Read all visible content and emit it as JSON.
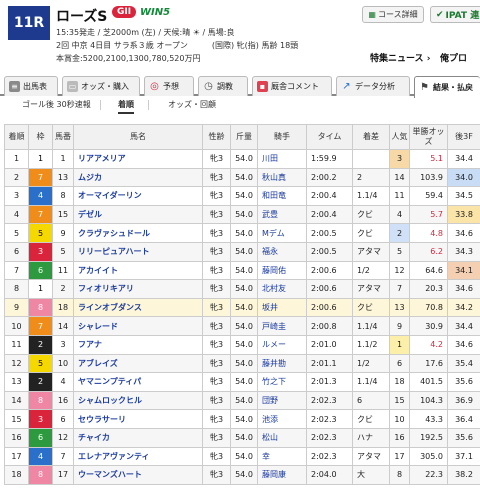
{
  "race": {
    "number": "11R",
    "name": "ローズS",
    "grade": "GII",
    "win5": "WIN5",
    "info1": "15:35発走 / 芝2000m (左) / 天候:晴 ☀ / 馬場:良",
    "info2": "2回 中京 4日目 サラ系３歳 オープン　　　(国際) 牝(指) 馬齢 18頭",
    "info3": "本賞金:5200,2100,1300,780,520万円"
  },
  "header_buttons": {
    "course": "コース詳細",
    "ipat": "IPAT 連",
    "special": "特集ニュース",
    "mypred": "俺プロ"
  },
  "tabs": [
    {
      "label": "出馬表",
      "icon": "list-icon"
    },
    {
      "label": "オッズ・購入",
      "icon": "ticket-icon"
    },
    {
      "label": "予想",
      "icon": "target-icon"
    },
    {
      "label": "調教",
      "icon": "stopwatch-icon"
    },
    {
      "label": "厩舎コメント",
      "icon": "comment-icon"
    },
    {
      "label": "データ分析",
      "icon": "chart-icon"
    },
    {
      "label": "結果・払戻",
      "icon": "flag-icon"
    }
  ],
  "subtabs": [
    "ゴール後 30秒速報",
    "着順",
    "オッズ・回顧"
  ],
  "columns": {
    "finish": "着順",
    "waku": "枠",
    "umaban": "馬番",
    "name": "馬名",
    "sexage": "性齢",
    "weight": "斤量",
    "jockey": "騎手",
    "time": "タイム",
    "margin": "着差",
    "pop": "人気",
    "odds": "単勝オッズ",
    "last3f": "後3F"
  },
  "rows": [
    {
      "finish": "1",
      "waku": "1",
      "umaban": "1",
      "name": "リアアメリア",
      "sexage": "牝3",
      "weight": "54.0",
      "jockey": "川田",
      "time": "1:59.9",
      "margin": "",
      "pop": "3",
      "odds": "5.1",
      "last3f": "34.4"
    },
    {
      "finish": "2",
      "waku": "7",
      "umaban": "13",
      "name": "ムジカ",
      "sexage": "牝3",
      "weight": "54.0",
      "jockey": "秋山真",
      "time": "2:00.2",
      "margin": "2",
      "pop": "14",
      "odds": "103.9",
      "last3f": "34.0"
    },
    {
      "finish": "3",
      "waku": "4",
      "umaban": "8",
      "name": "オーマイダーリン",
      "sexage": "牝3",
      "weight": "54.0",
      "jockey": "和田竜",
      "time": "2:00.4",
      "margin": "1.1/4",
      "pop": "11",
      "odds": "59.4",
      "last3f": "34.5"
    },
    {
      "finish": "4",
      "waku": "7",
      "umaban": "15",
      "name": "デゼル",
      "sexage": "牝3",
      "weight": "54.0",
      "jockey": "武豊",
      "time": "2:00.4",
      "margin": "クビ",
      "pop": "4",
      "odds": "5.7",
      "last3f": "33.8"
    },
    {
      "finish": "5",
      "waku": "5",
      "umaban": "9",
      "name": "クラヴァシュドール",
      "sexage": "牝3",
      "weight": "54.0",
      "jockey": "Mデム",
      "time": "2:00.5",
      "margin": "クビ",
      "pop": "2",
      "odds": "4.8",
      "last3f": "34.6"
    },
    {
      "finish": "6",
      "waku": "3",
      "umaban": "5",
      "name": "リリーピュアハート",
      "sexage": "牝3",
      "weight": "54.0",
      "jockey": "福永",
      "time": "2:00.5",
      "margin": "アタマ",
      "pop": "5",
      "odds": "6.2",
      "last3f": "34.3"
    },
    {
      "finish": "7",
      "waku": "6",
      "umaban": "11",
      "name": "アカイイト",
      "sexage": "牝3",
      "weight": "54.0",
      "jockey": "藤岡佑",
      "time": "2:00.6",
      "margin": "1/2",
      "pop": "12",
      "odds": "64.6",
      "last3f": "34.1"
    },
    {
      "finish": "8",
      "waku": "1",
      "umaban": "2",
      "name": "フィオリキアリ",
      "sexage": "牝3",
      "weight": "54.0",
      "jockey": "北村友",
      "time": "2:00.6",
      "margin": "アタマ",
      "pop": "7",
      "odds": "20.3",
      "last3f": "34.6"
    },
    {
      "finish": "9",
      "waku": "8",
      "umaban": "18",
      "name": "ラインオブダンス",
      "sexage": "牝3",
      "weight": "54.0",
      "jockey": "坂井",
      "time": "2:00.6",
      "margin": "クビ",
      "pop": "13",
      "odds": "70.8",
      "last3f": "34.2"
    },
    {
      "finish": "10",
      "waku": "7",
      "umaban": "14",
      "name": "シャレード",
      "sexage": "牝3",
      "weight": "54.0",
      "jockey": "戸崎圭",
      "time": "2:00.8",
      "margin": "1.1/4",
      "pop": "9",
      "odds": "30.9",
      "last3f": "34.4"
    },
    {
      "finish": "11",
      "waku": "2",
      "umaban": "3",
      "name": "フアナ",
      "sexage": "牝3",
      "weight": "54.0",
      "jockey": "ルメー",
      "time": "2:01.0",
      "margin": "1.1/2",
      "pop": "1",
      "odds": "4.2",
      "last3f": "34.6"
    },
    {
      "finish": "12",
      "waku": "5",
      "umaban": "10",
      "name": "アブレイズ",
      "sexage": "牝3",
      "weight": "54.0",
      "jockey": "藤井勘",
      "time": "2:01.1",
      "margin": "1/2",
      "pop": "6",
      "odds": "17.6",
      "last3f": "35.4"
    },
    {
      "finish": "13",
      "waku": "2",
      "umaban": "4",
      "name": "ヤマニンプティパ",
      "sexage": "牝3",
      "weight": "54.0",
      "jockey": "竹之下",
      "time": "2:01.3",
      "margin": "1.1/4",
      "pop": "18",
      "odds": "401.5",
      "last3f": "35.6"
    },
    {
      "finish": "14",
      "waku": "8",
      "umaban": "16",
      "name": "シャムロックヒル",
      "sexage": "牝3",
      "weight": "54.0",
      "jockey": "団野",
      "time": "2:02.3",
      "margin": "6",
      "pop": "15",
      "odds": "104.3",
      "last3f": "36.9"
    },
    {
      "finish": "15",
      "waku": "3",
      "umaban": "6",
      "name": "セウラサーリ",
      "sexage": "牝3",
      "weight": "54.0",
      "jockey": "池添",
      "time": "2:02.3",
      "margin": "クビ",
      "pop": "10",
      "odds": "43.3",
      "last3f": "36.4"
    },
    {
      "finish": "16",
      "waku": "6",
      "umaban": "12",
      "name": "チャイカ",
      "sexage": "牝3",
      "weight": "54.0",
      "jockey": "松山",
      "time": "2:02.3",
      "margin": "ハナ",
      "pop": "16",
      "odds": "192.5",
      "last3f": "35.6"
    },
    {
      "finish": "17",
      "waku": "4",
      "umaban": "7",
      "name": "エレナアヴァンティ",
      "sexage": "牝3",
      "weight": "54.0",
      "jockey": "幸",
      "time": "2:02.3",
      "margin": "アタマ",
      "pop": "17",
      "odds": "305.0",
      "last3f": "37.1"
    },
    {
      "finish": "18",
      "waku": "8",
      "umaban": "17",
      "name": "ウーマンズハート",
      "sexage": "牝3",
      "weight": "54.0",
      "jockey": "藤岡康",
      "time": "2:04.0",
      "margin": "大",
      "pop": "8",
      "odds": "22.3",
      "last3f": "38.2"
    }
  ]
}
